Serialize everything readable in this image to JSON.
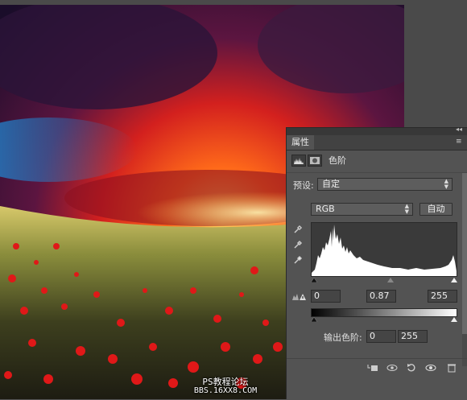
{
  "watermark": {
    "line1": "PS教程论坛",
    "line2": "BBS.16XX8.COM"
  },
  "panel": {
    "tab_label": "属性",
    "collapse_glyph": "◂◂",
    "menu_glyph": "≡",
    "title": "色阶",
    "preset_label": "预设:",
    "preset_value": "自定",
    "channel_value": "RGB",
    "auto_button": "自动",
    "input_black": "0",
    "input_gamma": "0.87",
    "input_white": "255",
    "output_label": "输出色阶:",
    "output_black": "0",
    "output_white": "255"
  },
  "icons": [
    "levels-icon",
    "mask-icon",
    "eyedropper-black-icon",
    "eyedropper-gray-icon",
    "eyedropper-white-icon",
    "clipping-warning-icon",
    "clip-to-layer-icon",
    "view-previous-icon",
    "reset-icon",
    "visibility-icon",
    "trash-icon"
  ],
  "colors": {
    "panel_bg": "#535353",
    "field_bg": "#454545",
    "dark_border": "#2a2a2a"
  }
}
